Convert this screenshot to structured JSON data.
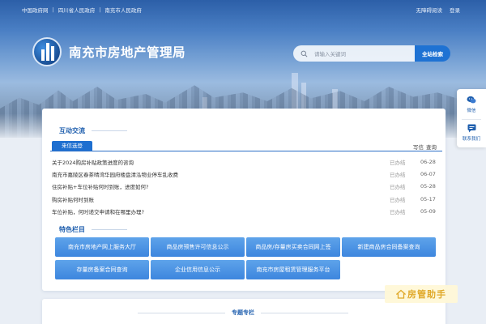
{
  "topbar": {
    "links": [
      "中国政府网",
      "四川省人民政府",
      "南充市人民政府"
    ],
    "accessibility": "无障碍阅读",
    "login": "登录"
  },
  "header": {
    "site_title": "南充市房地产管理局",
    "logo_icon": "building-logo-icon"
  },
  "search": {
    "placeholder": "请输入关键词",
    "button_label": "全站检索"
  },
  "interaction": {
    "section_title": "互动交流",
    "tab_label": "来信选登",
    "col_status": "写信",
    "col_date": "查询",
    "rows": [
      {
        "question": "关于2024购房补贴政策进度的咨询",
        "status": "已办结",
        "date": "06-28"
      },
      {
        "question": "南充市嘉陵区春茶晴湾华园府楼盘清泓物业停车乱收费",
        "status": "已办结",
        "date": "06-07"
      },
      {
        "question": "住房补贴+车位补贴何时到账，进度如何?",
        "status": "已办结",
        "date": "05-28"
      },
      {
        "question": "购房补贴何时到账",
        "status": "已办结",
        "date": "05-17"
      },
      {
        "question": "车位补贴，何时递交申请和在哪里办理?",
        "status": "已办结",
        "date": "05-09"
      }
    ]
  },
  "featured": {
    "section_title": "特色栏目",
    "buttons": [
      "南充市房地产网上服务大厅",
      "商品房预售许可信息公示",
      "商品房/存量房买卖合同网上签",
      "新建商品房合同备案查询",
      "存量房备案合同查询",
      "企业信用信息公示",
      "南充市房屋租赁管理服务平台"
    ]
  },
  "special": {
    "section_title": "专题专栏"
  },
  "sidebar": {
    "wechat_label": "微信",
    "contact_label": "联系我们"
  },
  "watermark": {
    "text": "房管助手"
  },
  "colors": {
    "brand_blue": "#1e6fd0",
    "button_blue": "#3d86de",
    "title_blue": "#1f5fae",
    "watermark_gold": "#e0a92a"
  }
}
